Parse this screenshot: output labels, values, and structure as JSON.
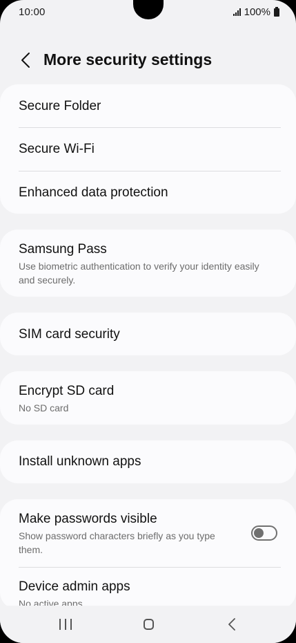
{
  "status_bar": {
    "time": "10:00",
    "battery": "100%",
    "icons": [
      "signal-icon",
      "battery-icon"
    ]
  },
  "header": {
    "title": "More security settings",
    "back_icon": "chevron-left-icon"
  },
  "items": [
    {
      "title": "Secure Folder"
    },
    {
      "title": "Secure Wi-Fi"
    },
    {
      "title": "Enhanced data protection"
    },
    {
      "title": "Samsung Pass",
      "subtitle": "Use biometric authentication to verify your identity easily and securely."
    },
    {
      "title": "SIM card security"
    },
    {
      "title": "Encrypt SD card",
      "subtitle": "No SD card"
    },
    {
      "title": "Install unknown apps"
    },
    {
      "title": "Make passwords visible",
      "subtitle": "Show password characters briefly as you type them.",
      "toggle": "off"
    },
    {
      "title": "Device admin apps",
      "subtitle": "No active apps"
    }
  ],
  "nav_bar": {
    "icons": [
      "recents-icon",
      "home-icon",
      "back-icon"
    ]
  },
  "colors": {
    "background": "#f2f2f4",
    "card": "#fbfbfd",
    "divider": "#dcdcdf",
    "toggle_off": "#707070"
  }
}
